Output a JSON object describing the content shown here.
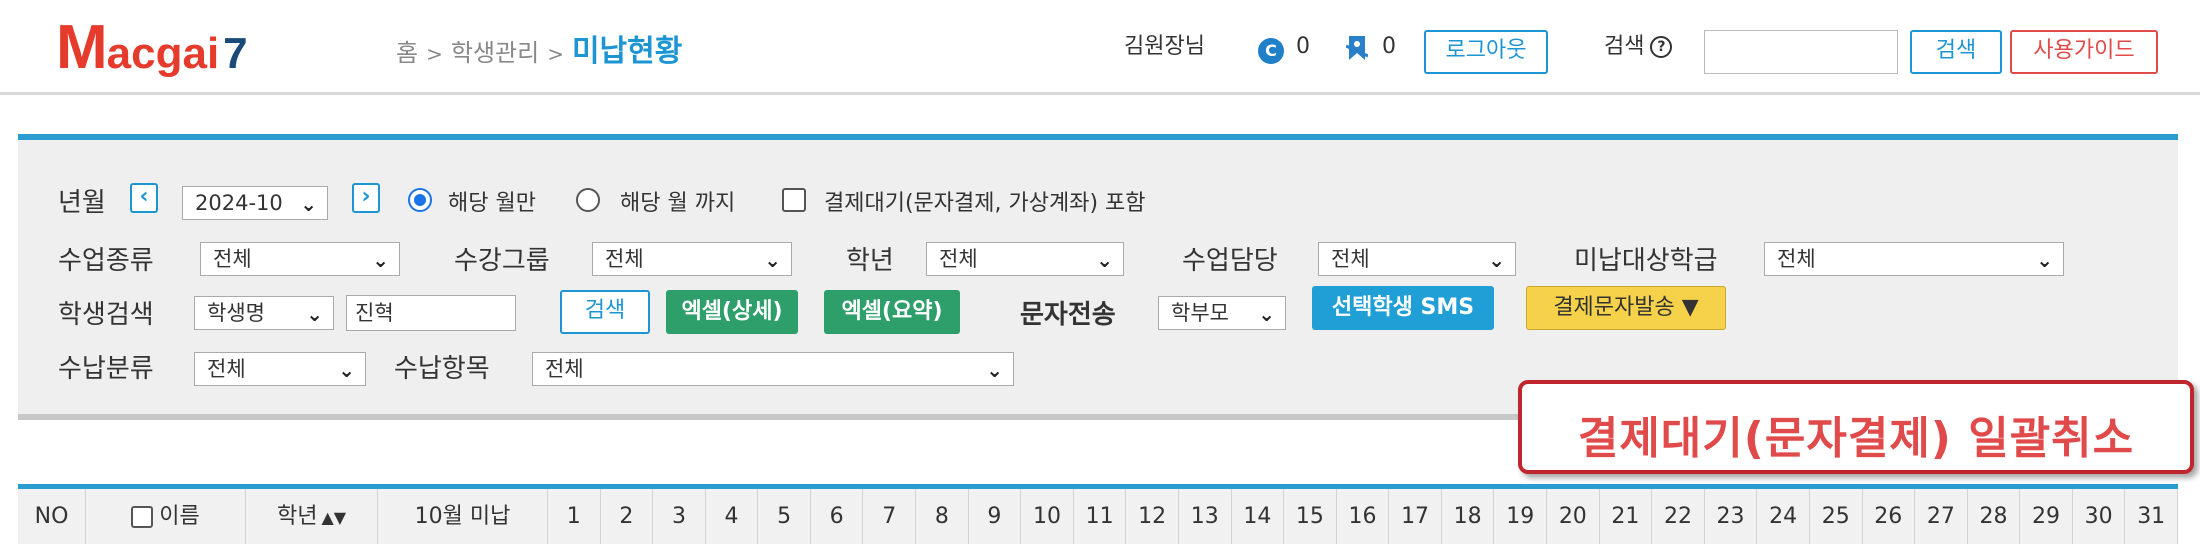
{
  "header": {
    "logo": {
      "m": "M",
      "rest": "acgai",
      "num": "7"
    },
    "breadcrumb": {
      "home": "홈",
      "sep": ">",
      "section": "학생관리",
      "current": "미납현황"
    },
    "user": "김원장님",
    "counter1": "0",
    "counter2": "0",
    "logout_label": "로그아웃",
    "search_label": "검색",
    "search_value": "",
    "search_button": "검색",
    "guide_button": "사용가이드"
  },
  "filters": {
    "month_label": "년월",
    "month_value": "2024-10",
    "radio_month_only": "해당 월만",
    "radio_until_month": "해당 월 까지",
    "include_pending": "결제대기(문자결제, 가상계좌) 포함",
    "class_type_label": "수업종류",
    "class_type_value": "전체",
    "group_label": "수강그룹",
    "group_value": "전체",
    "grade_label": "학년",
    "grade_value": "전체",
    "teacher_label": "수업담당",
    "teacher_value": "전체",
    "target_class_label": "미납대상학급",
    "target_class_value": "전체",
    "student_search_label": "학생검색",
    "student_search_field": "학생명",
    "student_search_value": "진혁",
    "search_button": "검색",
    "excel_detail": "엑셀(상세)",
    "excel_summary": "엑셀(요약)",
    "sms_label": "문자전송",
    "sms_target": "학부모",
    "selected_sms": "선택학생 SMS",
    "payment_sms": "결제문자발송 ▼",
    "category_label": "수납분류",
    "category_value": "전체",
    "item_label": "수납항목",
    "item_value": "전체"
  },
  "callout": "결제대기(문자결제) 일괄취소",
  "table": {
    "no": "NO",
    "name": "이름",
    "grade": "학년",
    "unpaid": "10월 미납",
    "days": [
      "1",
      "2",
      "3",
      "4",
      "5",
      "6",
      "7",
      "8",
      "9",
      "10",
      "11",
      "12",
      "13",
      "14",
      "15",
      "16",
      "17",
      "18",
      "19",
      "20",
      "21",
      "22",
      "23",
      "24",
      "25",
      "26",
      "27",
      "28",
      "29",
      "30",
      "31"
    ]
  }
}
